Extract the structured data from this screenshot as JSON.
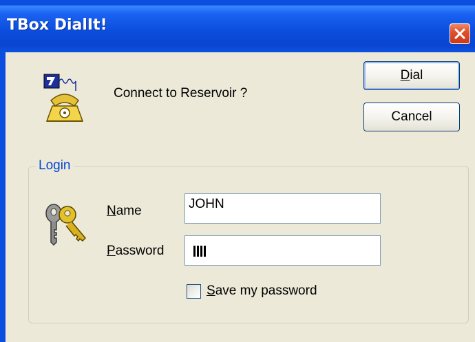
{
  "window": {
    "title": "TBox DialIt!",
    "close_icon": "close-icon"
  },
  "dialog": {
    "icon": "phone-modem-icon",
    "prompt": "Connect to Reservoir ?"
  },
  "buttons": {
    "dial_access_key": "D",
    "dial_rest": "ial",
    "cancel_label": "Cancel"
  },
  "login": {
    "group_label": "Login",
    "icon": "keys-icon",
    "name_access_key": "N",
    "name_rest": "ame",
    "name_value": "JOHN",
    "password_access_key": "P",
    "password_rest": "assword",
    "password_mask": "||||",
    "save_access_key": "S",
    "save_rest": "ave my password",
    "save_checked": false
  },
  "colors": {
    "titlebar": "#0a4fe0",
    "dialog_bg": "#ece9d8",
    "group_label": "#0046d5",
    "close_button": "#e0502c"
  }
}
